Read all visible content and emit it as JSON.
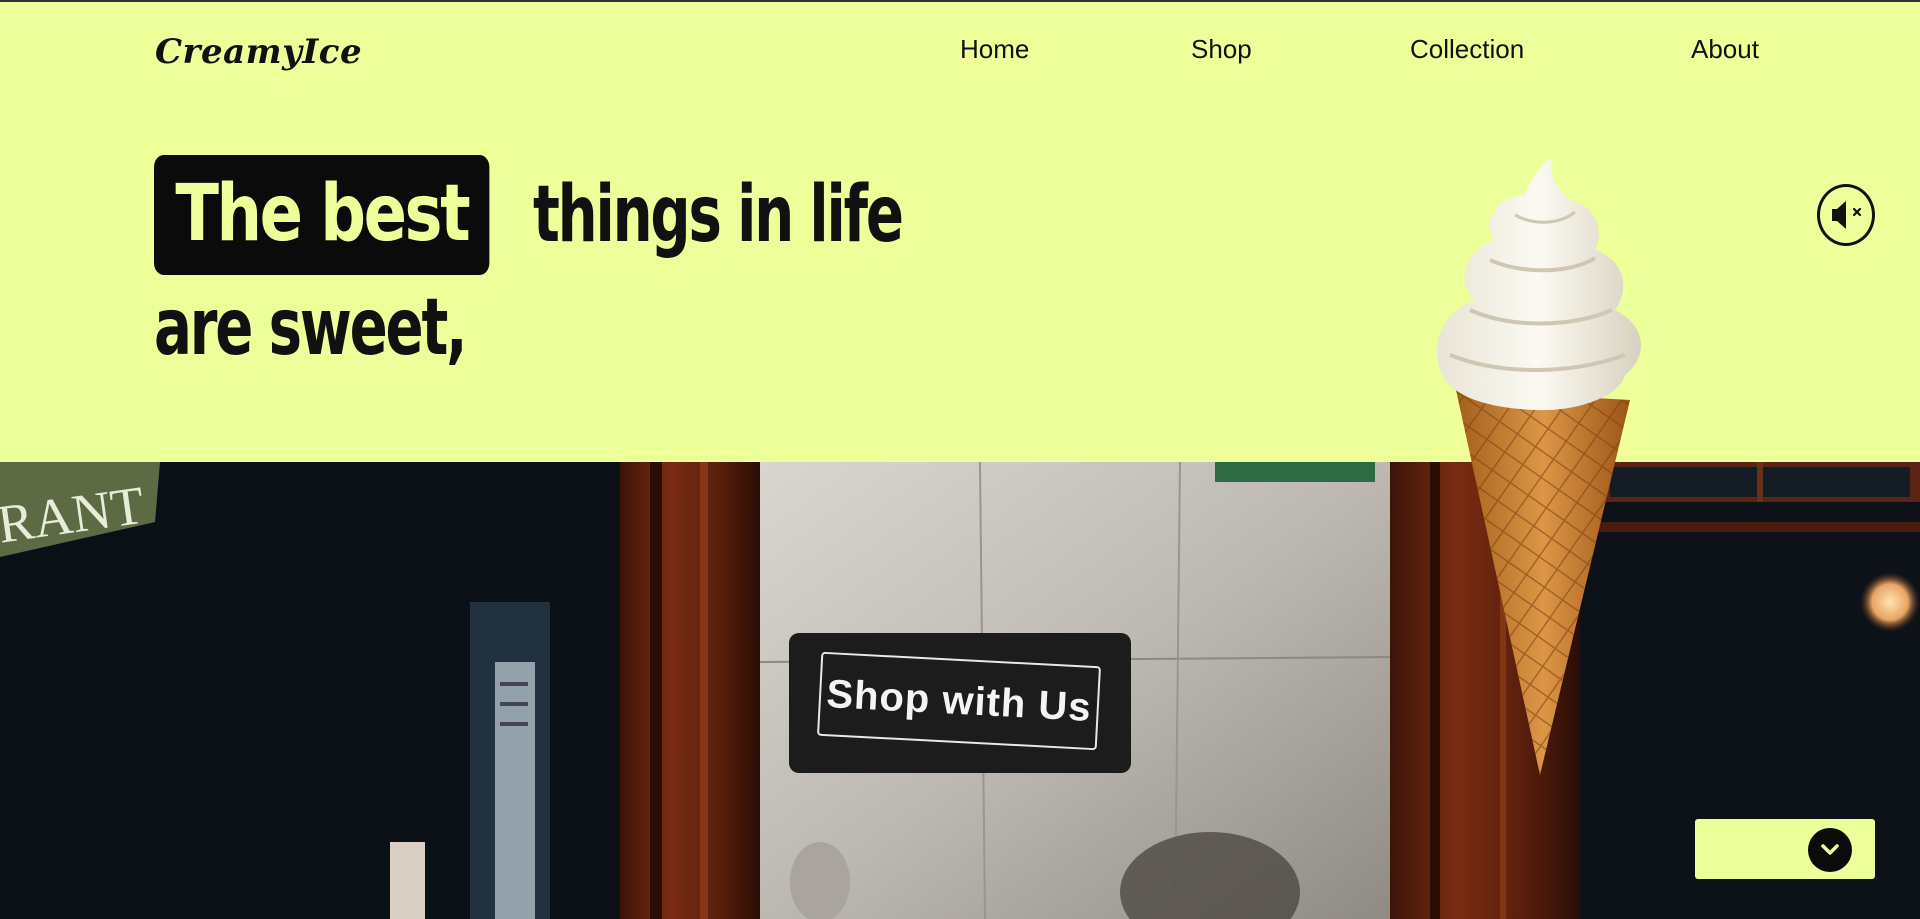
{
  "brand": {
    "logo_text": "CreamyIce"
  },
  "nav": {
    "items": [
      {
        "label": "Home"
      },
      {
        "label": "Shop"
      },
      {
        "label": "Collection"
      },
      {
        "label": "About"
      }
    ]
  },
  "hero": {
    "highlight": "The best",
    "line1_rest": "things in life",
    "line2": "are sweet,",
    "mute_icon": "speaker-muted-icon",
    "cta_label": "Shop with Us",
    "scroll_icon": "chevron-down-icon",
    "storefront_sign_text": "RANT"
  },
  "colors": {
    "background": "#ecff99",
    "highlight_bg": "#0b0b0b",
    "text": "#111111",
    "cta_bg": "#1c1c1c"
  }
}
